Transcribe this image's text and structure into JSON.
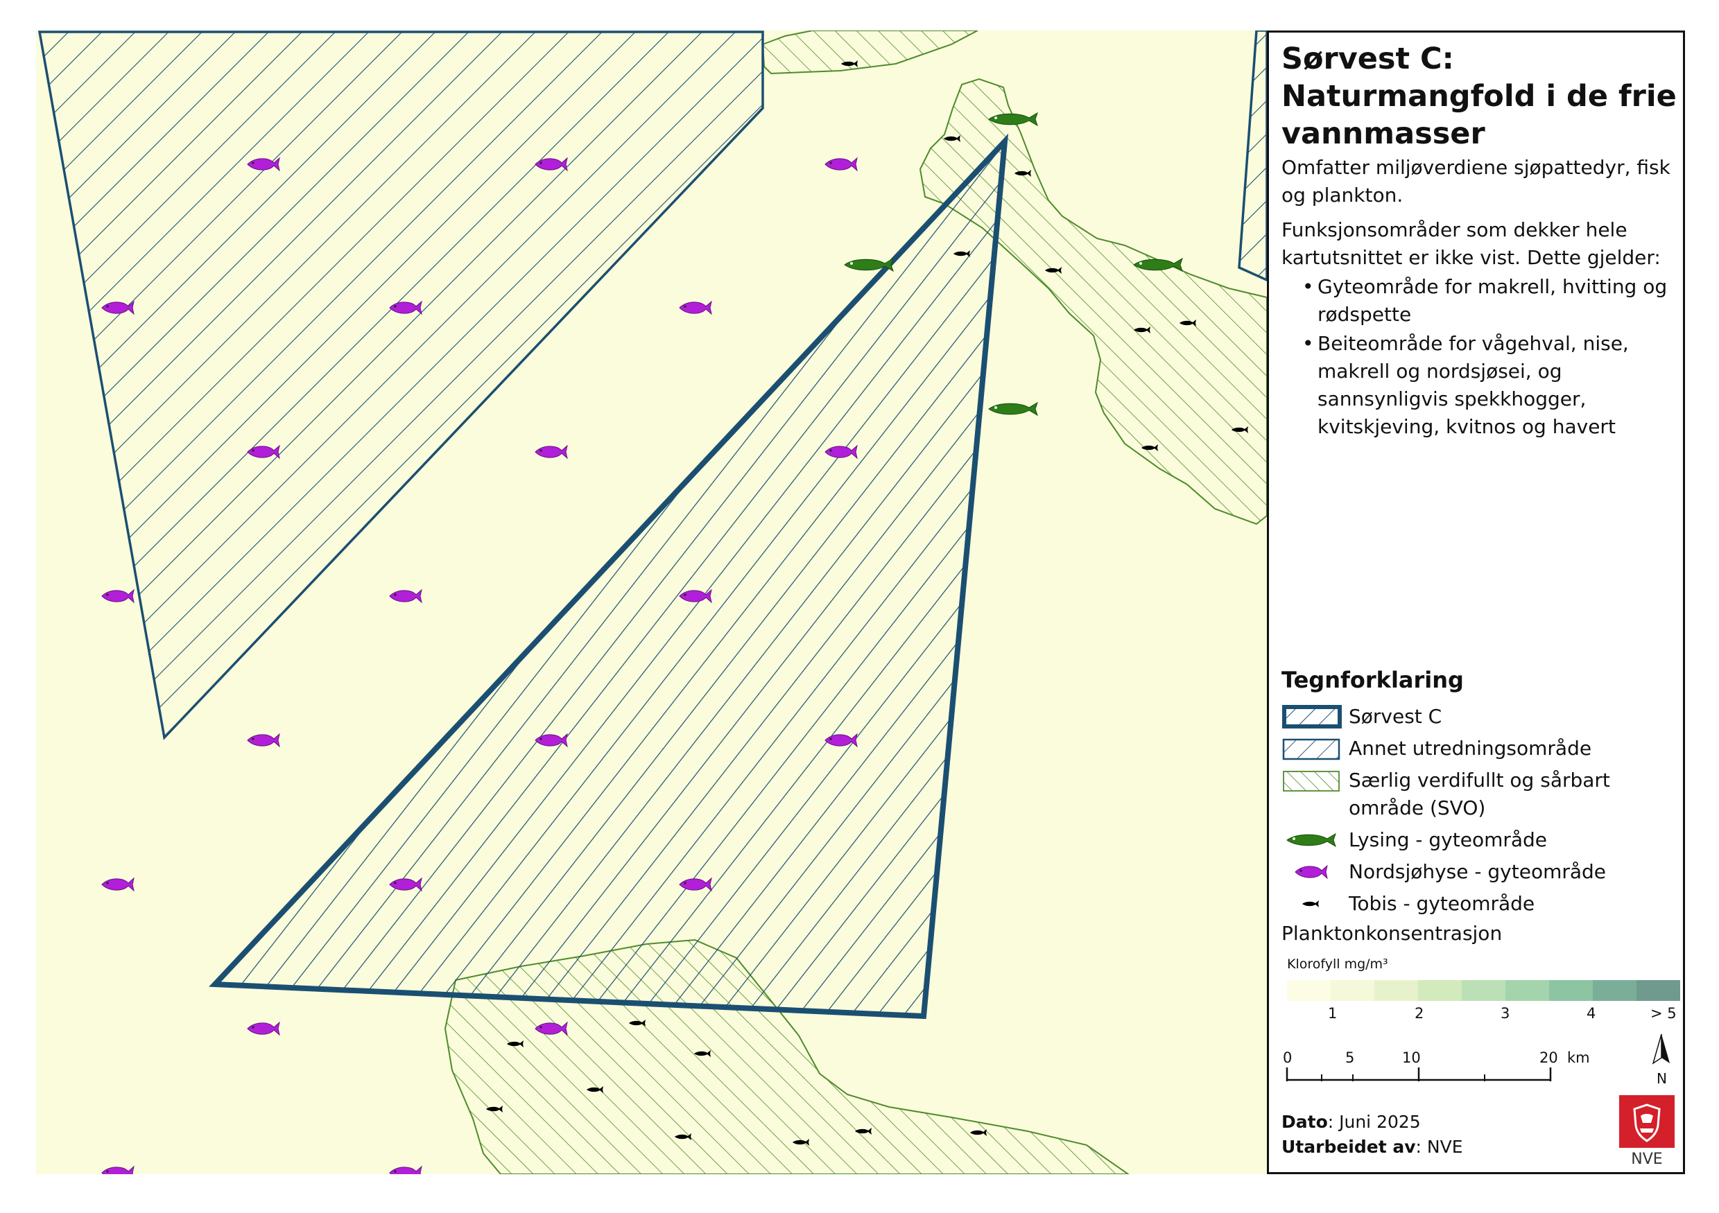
{
  "title": "Sørvest C: Naturmangfold i de frie vannmasser",
  "description": "Omfatter miljøverdiene sjøpattedyr, fisk og plankton.",
  "functional_areas_intro": "Funksjonsområder som dekker hele kartutsnittet er ikke vist. Dette gjelder:",
  "functional_areas": [
    "Gyteområde for makrell, hvitting og rødspette",
    "Beiteområde for vågehval, nise, makrell og nordsjøsei, og sannsynligvis spekkhogger, kvitskjeving, kvitnos og havert"
  ],
  "legend": {
    "title": "Tegnforklaring",
    "items": [
      {
        "label": "Sørvest C",
        "color": "#1b4f72"
      },
      {
        "label": "Annet utredningsområde",
        "color": "#1b4f72"
      },
      {
        "label": "Særlig verdifullt og sårbart område (SVO)",
        "color": "#4f8a2c"
      },
      {
        "label": "Lysing - gyteområde",
        "color": "#2e7d18",
        "icon": "fish-icon"
      },
      {
        "label": "Nordsjøhyse - gyteområde",
        "color": "#b11fd8",
        "icon": "fish-icon"
      },
      {
        "label": "Tobis - gyteområde",
        "color": "#000000",
        "icon": "small-fish-icon"
      }
    ]
  },
  "plankton": {
    "title": "Planktonkonsentrasjon",
    "unit": "Klorofyll mg/m³",
    "ramp_colors": [
      "#fcfde4",
      "#f6f9d9",
      "#e7f2cc",
      "#d2eabc",
      "#bce0b5",
      "#a3d4ab",
      "#8dc4a2",
      "#7aae99",
      "#6f9a8d"
    ],
    "labels": [
      "1",
      "2",
      "3",
      "4",
      "> 5"
    ]
  },
  "scalebar": {
    "labels": [
      "0",
      "5",
      "10",
      "20"
    ],
    "unit": "km"
  },
  "north_label": "N",
  "date_label": "Dato",
  "date_value": ": Juni 2025",
  "author_label": "Utarbeidet av",
  "author_value": ": NVE",
  "logo_text": "NVE",
  "map": {
    "background": "#fafcdb"
  }
}
